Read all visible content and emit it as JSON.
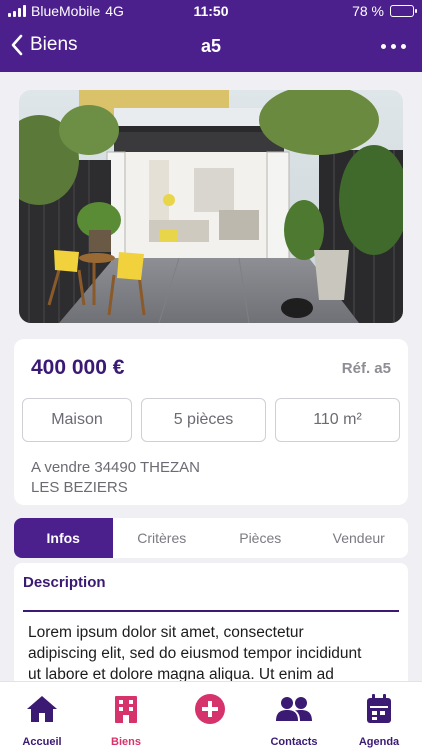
{
  "status_bar": {
    "carrier": "BlueMobile",
    "network": "4G",
    "time": "11:50",
    "battery_percent": "78 %",
    "battery_level": 0.78
  },
  "nav": {
    "back_label": "Biens",
    "title": "a5",
    "more_icon": "more-dots-icon"
  },
  "property": {
    "photo_icon": "house-patio-photo",
    "price": "400 000 €",
    "reference": "Réf. a5",
    "type": "Maison",
    "rooms": "5 pièces",
    "surface": "110 m²",
    "address_line1": "A vendre 34490 THEZAN",
    "address_line2": "LES BEZIERS"
  },
  "tabs": [
    {
      "label": "Infos",
      "active": true
    },
    {
      "label": "Critères",
      "active": false
    },
    {
      "label": "Pièces",
      "active": false
    },
    {
      "label": "Vendeur",
      "active": false
    }
  ],
  "description": {
    "title": "Description",
    "line1": "Lorem ipsum dolor sit amet, consectetur",
    "line2": "adipiscing elit, sed do eiusmod tempor incididunt",
    "line3": "ut labore et dolore magna aliqua. Ut enim ad"
  },
  "tab_bar": {
    "items": [
      {
        "label": "Accueil",
        "icon": "home-icon",
        "active": false
      },
      {
        "label": "Biens",
        "icon": "building-icon",
        "active": true
      },
      {
        "label": "",
        "icon": "plus-circle-icon",
        "active": false
      },
      {
        "label": "Contacts",
        "icon": "contacts-icon",
        "active": false
      },
      {
        "label": "Agenda",
        "icon": "calendar-icon",
        "active": false
      }
    ]
  },
  "colors": {
    "primary": "#4b1f8c",
    "accent": "#d6336c",
    "title": "#3b1a74"
  }
}
